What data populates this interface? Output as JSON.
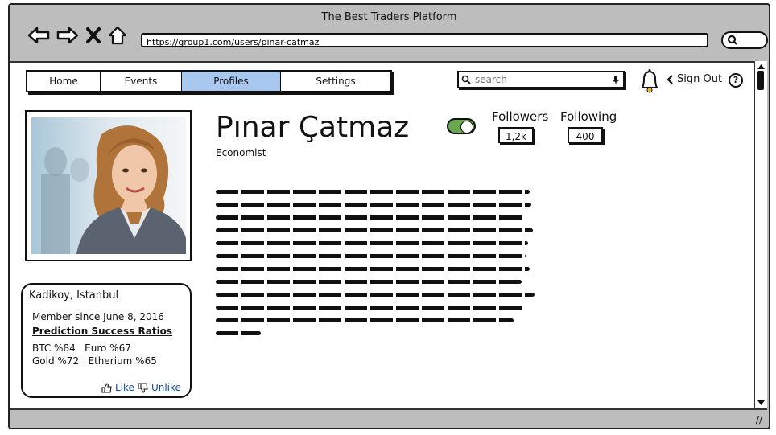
{
  "window": {
    "title": "The Best Traders Platform",
    "url": "https://group1.com/users/pinar-catmaz"
  },
  "nav": {
    "tabs": [
      {
        "label": "Home"
      },
      {
        "label": "Events"
      },
      {
        "label": "Profiles",
        "selected": true
      },
      {
        "label": "Settings"
      }
    ],
    "search_placeholder": "search",
    "sign_out": "Sign Out",
    "help": "?"
  },
  "profile": {
    "name": "Pınar Çatmaz",
    "role": "Economist",
    "followers_label": "Followers",
    "followers_count": "1,2k",
    "following_label": "Following",
    "following_count": "400"
  },
  "card": {
    "location": "Kadikoy, Istanbul",
    "member_since": "Member since June 8, 2016",
    "prediction_title": "Prediction Success Ratios",
    "row1": "BTC %84   Euro %67",
    "row2": "Gold %72   Etherium %65",
    "like": "Like",
    "unlike": "Unlike"
  },
  "colors": {
    "selected_tab": "#a8c8f0",
    "toggle_on": "#6aa84f",
    "link": "#1a4b8c"
  }
}
